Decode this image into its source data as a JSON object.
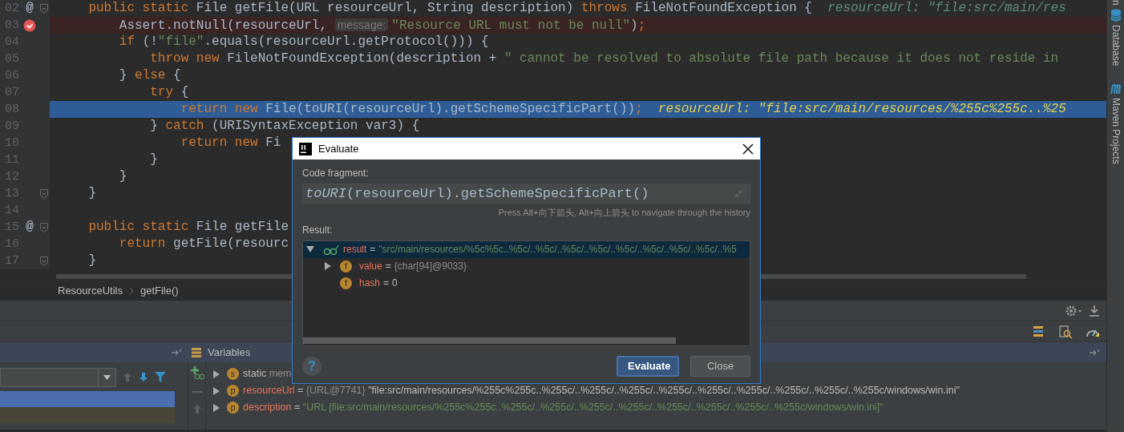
{
  "editor": {
    "lines": [
      {
        "number": "02",
        "marker": {
          "kind": "override",
          "glyph": "@"
        },
        "fold": true,
        "breakpoint_hit": false,
        "execution_point": false,
        "tokens": [
          {
            "kind": "keyword",
            "text": "    public static "
          },
          {
            "kind": "text",
            "text": "File getFile(URL resourceUrl, String description) "
          },
          {
            "kind": "keyword",
            "text": "throws "
          },
          {
            "kind": "text",
            "text": "FileNotFoundException {  "
          },
          {
            "kind": "debug_value",
            "text": "resourceUrl: \"file:src/main/res"
          }
        ]
      },
      {
        "number": "03",
        "marker": {
          "kind": "breakpoint"
        },
        "fold": false,
        "breakpoint_hit": true,
        "execution_point": false,
        "tokens": [
          {
            "kind": "text",
            "text": "        Assert.notNull(resourceUrl, "
          },
          {
            "kind": "param_hint",
            "text": "message:"
          },
          {
            "kind": "string",
            "text": "\"Resource URL must not be null\""
          },
          {
            "kind": "text",
            "text": ")"
          },
          {
            "kind": "keyword",
            "text": ";"
          }
        ]
      },
      {
        "number": "04",
        "fold": false,
        "breakpoint_hit": false,
        "execution_point": false,
        "tokens": [
          {
            "kind": "keyword",
            "text": "        if "
          },
          {
            "kind": "text",
            "text": "(!"
          },
          {
            "kind": "string",
            "text": "\"file\""
          },
          {
            "kind": "text",
            "text": ".equals(resourceUrl.getProtocol())) {"
          }
        ]
      },
      {
        "number": "05",
        "fold": false,
        "breakpoint_hit": false,
        "execution_point": false,
        "tokens": [
          {
            "kind": "keyword",
            "text": "            throw new "
          },
          {
            "kind": "text",
            "text": "FileNotFoundException(description + "
          },
          {
            "kind": "string",
            "text": "\" cannot be resolved to absolute file path because it does not reside in"
          }
        ]
      },
      {
        "number": "06",
        "fold": false,
        "breakpoint_hit": false,
        "execution_point": false,
        "tokens": [
          {
            "kind": "text",
            "text": "        } "
          },
          {
            "kind": "keyword",
            "text": "else "
          },
          {
            "kind": "text",
            "text": "{"
          }
        ]
      },
      {
        "number": "07",
        "fold": false,
        "breakpoint_hit": false,
        "execution_point": false,
        "tokens": [
          {
            "kind": "keyword",
            "text": "            try "
          },
          {
            "kind": "text",
            "text": "{"
          }
        ]
      },
      {
        "number": "08",
        "fold": false,
        "breakpoint_hit": false,
        "execution_point": true,
        "tokens": [
          {
            "kind": "keyword",
            "text": "                return new "
          },
          {
            "kind": "text",
            "text": "File(toURI(resourceUrl).getSchemeSpecificPart())"
          },
          {
            "kind": "keyword",
            "text": ";  "
          },
          {
            "kind": "exec_value",
            "text": "resourceUrl: \"file:src/main/resources/%255c%255c..%25"
          }
        ]
      },
      {
        "number": "09",
        "fold": false,
        "breakpoint_hit": false,
        "execution_point": false,
        "tokens": [
          {
            "kind": "text",
            "text": "            } "
          },
          {
            "kind": "keyword",
            "text": "catch "
          },
          {
            "kind": "text",
            "text": "(URISyntaxException var3) {"
          }
        ]
      },
      {
        "number": "10",
        "fold": false,
        "breakpoint_hit": false,
        "execution_point": false,
        "tokens": [
          {
            "kind": "keyword",
            "text": "                return new "
          },
          {
            "kind": "text",
            "text": "Fi"
          }
        ]
      },
      {
        "number": "11",
        "fold": false,
        "breakpoint_hit": false,
        "execution_point": false,
        "tokens": [
          {
            "kind": "text",
            "text": "            }"
          }
        ]
      },
      {
        "number": "12",
        "fold": false,
        "breakpoint_hit": false,
        "execution_point": false,
        "tokens": [
          {
            "kind": "text",
            "text": "        }"
          }
        ]
      },
      {
        "number": "13",
        "fold": true,
        "breakpoint_hit": false,
        "execution_point": false,
        "tokens": [
          {
            "kind": "text",
            "text": "    }"
          }
        ]
      },
      {
        "number": "14",
        "fold": false,
        "breakpoint_hit": false,
        "execution_point": false
      },
      {
        "number": "15",
        "marker": {
          "kind": "override",
          "glyph": "@"
        },
        "fold": true,
        "breakpoint_hit": false,
        "execution_point": false,
        "tokens": [
          {
            "kind": "keyword",
            "text": "    public static "
          },
          {
            "kind": "text",
            "text": "File getFile"
          }
        ]
      },
      {
        "number": "16",
        "fold": false,
        "breakpoint_hit": false,
        "execution_point": false,
        "tokens": [
          {
            "kind": "keyword",
            "text": "        return "
          },
          {
            "kind": "text",
            "text": "getFile(resourc"
          }
        ]
      },
      {
        "number": "17",
        "fold": true,
        "breakpoint_hit": false,
        "execution_point": false,
        "tokens": [
          {
            "kind": "text",
            "text": "    }"
          }
        ]
      }
    ]
  },
  "breadcrumb": [
    "ResourceUtils",
    "getFile()"
  ],
  "tool_strip": [
    "n",
    "Database",
    "Maven Projects"
  ],
  "debug": {
    "frames": [
      {
        "selected": true
      },
      {
        "selected": false
      }
    ],
    "variables_title": "Variables",
    "variables": [
      {
        "badge": "s",
        "expanded": false,
        "tokens": [
          {
            "kind": "plain",
            "text": "static"
          },
          {
            "kind": "muted",
            "text": " mem"
          }
        ]
      },
      {
        "badge": "p",
        "expanded": false,
        "tokens": [
          {
            "kind": "name",
            "text": "resourceUrl"
          },
          {
            "kind": "plain",
            "text": " = "
          },
          {
            "kind": "muted",
            "text": "{URL@7741} "
          },
          {
            "kind": "plain",
            "text": "\"file:src/main/resources/%255c%255c..%255c/..%255c/..%255c/..%255c/..%255c/..%255c/..%255c/..%255c/..%255c/windows/win.ini\""
          }
        ]
      },
      {
        "badge": "p",
        "expanded": false,
        "tokens": [
          {
            "kind": "name",
            "text": "description"
          },
          {
            "kind": "plain",
            "text": " = "
          },
          {
            "kind": "string",
            "text": "\"URL [file:src/main/resources/%255c%255c..%255c/..%255c/..%255c/..%255c/..%255c/..%255c/..%255c/..%255c/windows/win.ini]\""
          }
        ]
      }
    ]
  },
  "dialog": {
    "title": "Evaluate",
    "code_label": "Code fragment:",
    "code_value": "*toURI*(resourceUrl).getSchemeSpecificPart()",
    "hint": "Press Alt+向下箭头, Alt+向上箭头 to navigate through the history",
    "result_label": "Result:",
    "result": [
      {
        "name": "result",
        "op": "=",
        "value": "\"src/main/resources/%5c%5c..%5c/..%5c/..%5c/..%5c/..%5c/..%5c/..%5c/..%5c/..%5",
        "kind": "string",
        "expanded": true,
        "selected": true,
        "children": [
          {
            "badge": "f",
            "name": "value",
            "op": "=",
            "value": "{char[94]@9033}",
            "kind": "type",
            "expanded": false,
            "selected": false
          },
          {
            "badge": "f",
            "name": "hash",
            "op": "=",
            "value": "0",
            "kind": "plain",
            "selected": false
          }
        ]
      }
    ],
    "help": "?",
    "buttons": [
      {
        "label": "Evaluate",
        "default": true
      },
      {
        "label": "Close",
        "default": false
      }
    ]
  }
}
